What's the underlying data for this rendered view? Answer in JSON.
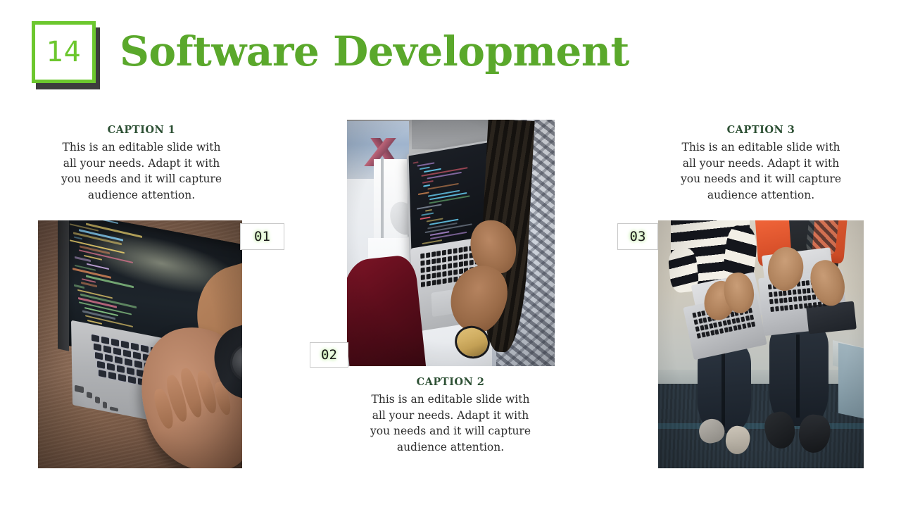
{
  "slide": {
    "number": "14",
    "title": "Software Development",
    "accent_green": "#5aa82b",
    "badge_green": "#6cc72e",
    "badge_shadow": "#3d3d3d",
    "caption_heading_green": "#2d5034",
    "body_text_color": "#2b2b2b",
    "background": "#ffffff"
  },
  "captions": [
    {
      "heading": "CAPTION 1",
      "body": "This is an editable slide with all your needs. Adapt it with you needs and it will capture audience attention.",
      "tag": "01"
    },
    {
      "heading": "CAPTION 2",
      "body": "This is an editable slide with all your needs. Adapt it with you needs and it will capture audience attention.",
      "tag": "02"
    },
    {
      "heading": "CAPTION 3",
      "body": "This is an editable slide with all your needs. Adapt it with you needs and it will capture audience attention.",
      "tag": "03"
    }
  ],
  "photos": [
    {
      "name": "photo-hand-typing-laptop-wooden-desk"
    },
    {
      "name": "photo-overhead-developer-coding-macbook"
    },
    {
      "name": "photo-two-people-bench-laptops"
    }
  ]
}
